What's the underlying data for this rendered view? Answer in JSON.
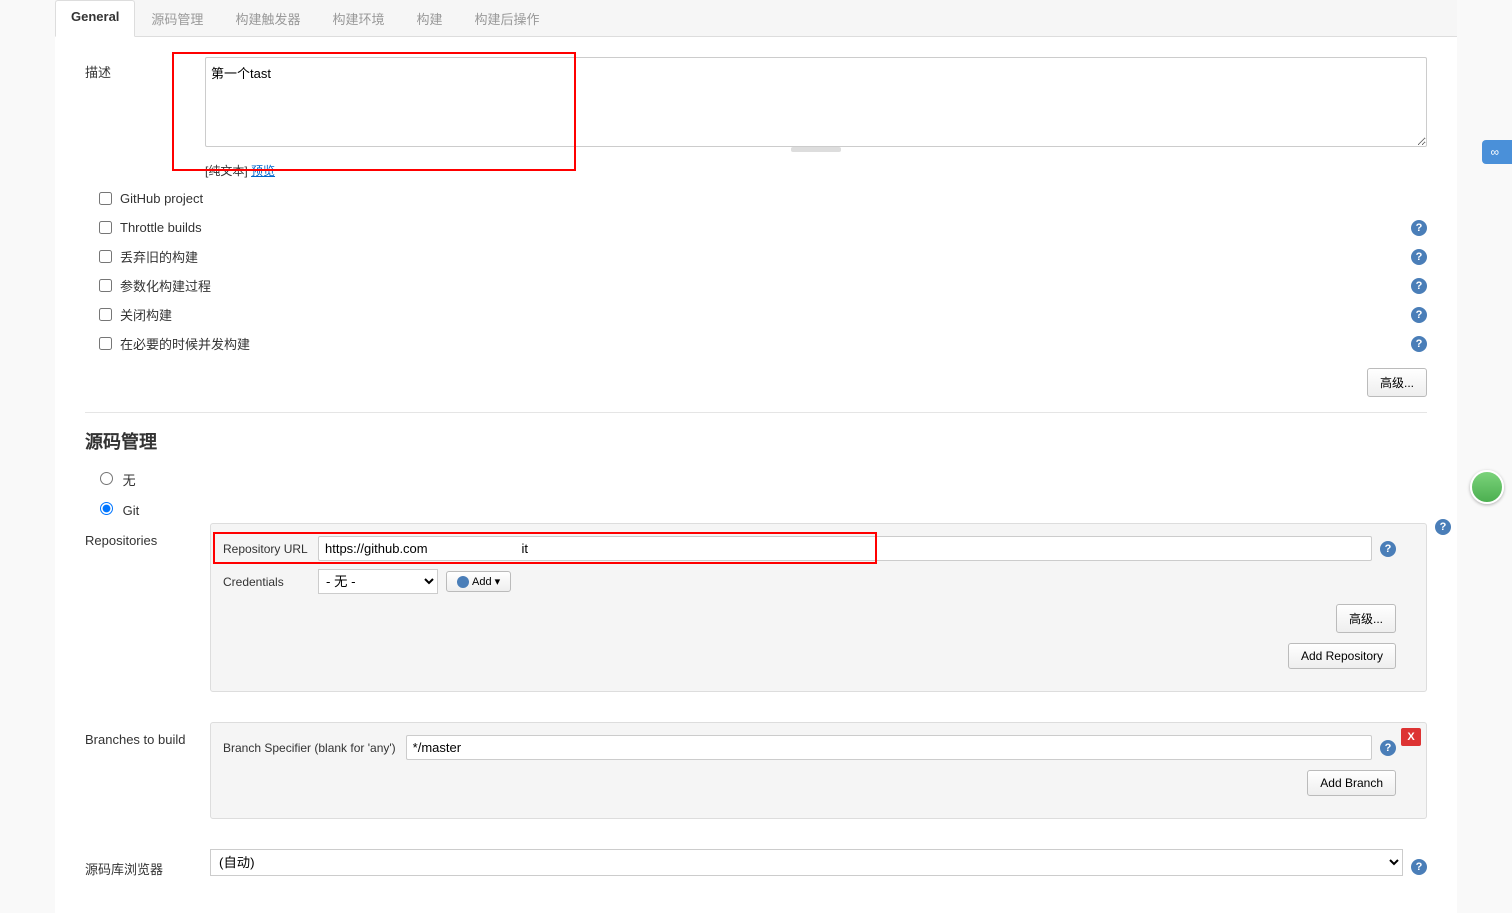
{
  "tabs": {
    "general": "General",
    "scm": "源码管理",
    "trigger": "构建触发器",
    "env": "构建环境",
    "build": "构建",
    "post": "构建后操作"
  },
  "description": {
    "label": "描述",
    "value": "第一个tast",
    "plaintext": "[纯文本]",
    "preview": "预览"
  },
  "checkboxes": {
    "github_project": "GitHub project",
    "throttle": "Throttle builds",
    "discard": "丢弃旧的构建",
    "param": "参数化构建过程",
    "disable": "关闭构建",
    "concurrent": "在必要的时候并发构建"
  },
  "advanced_btn": "高级...",
  "scm_section": {
    "title": "源码管理",
    "none": "无",
    "git": "Git"
  },
  "repositories": {
    "label": "Repositories",
    "url_label": "Repository URL",
    "url_value": "https://github.com                          it",
    "cred_label": "Credentials",
    "cred_value": "- 无 -",
    "add_label": "Add",
    "advanced": "高级...",
    "add_repo": "Add Repository"
  },
  "branches": {
    "label": "Branches to build",
    "specifier_label": "Branch Specifier (blank for 'any')",
    "specifier_value": "*/master",
    "x": "X",
    "add_branch": "Add Branch"
  },
  "browser": {
    "label": "源码库浏览器",
    "value": "(自动)"
  },
  "floating": {
    "label": ""
  }
}
